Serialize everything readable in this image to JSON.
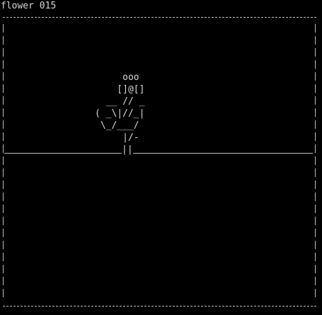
{
  "window": {
    "title": "flower 015"
  },
  "scene": {
    "flower_lines": [
      "     ooo",
      "    []@[]",
      "  __ // _",
      "( _\\|//_|",
      " \\_/___/",
      "     |/-"
    ],
    "stem_base": "||"
  },
  "colors": {
    "background": "#000000",
    "foreground": "#d6d6d6",
    "border": "#bdbdbd"
  }
}
